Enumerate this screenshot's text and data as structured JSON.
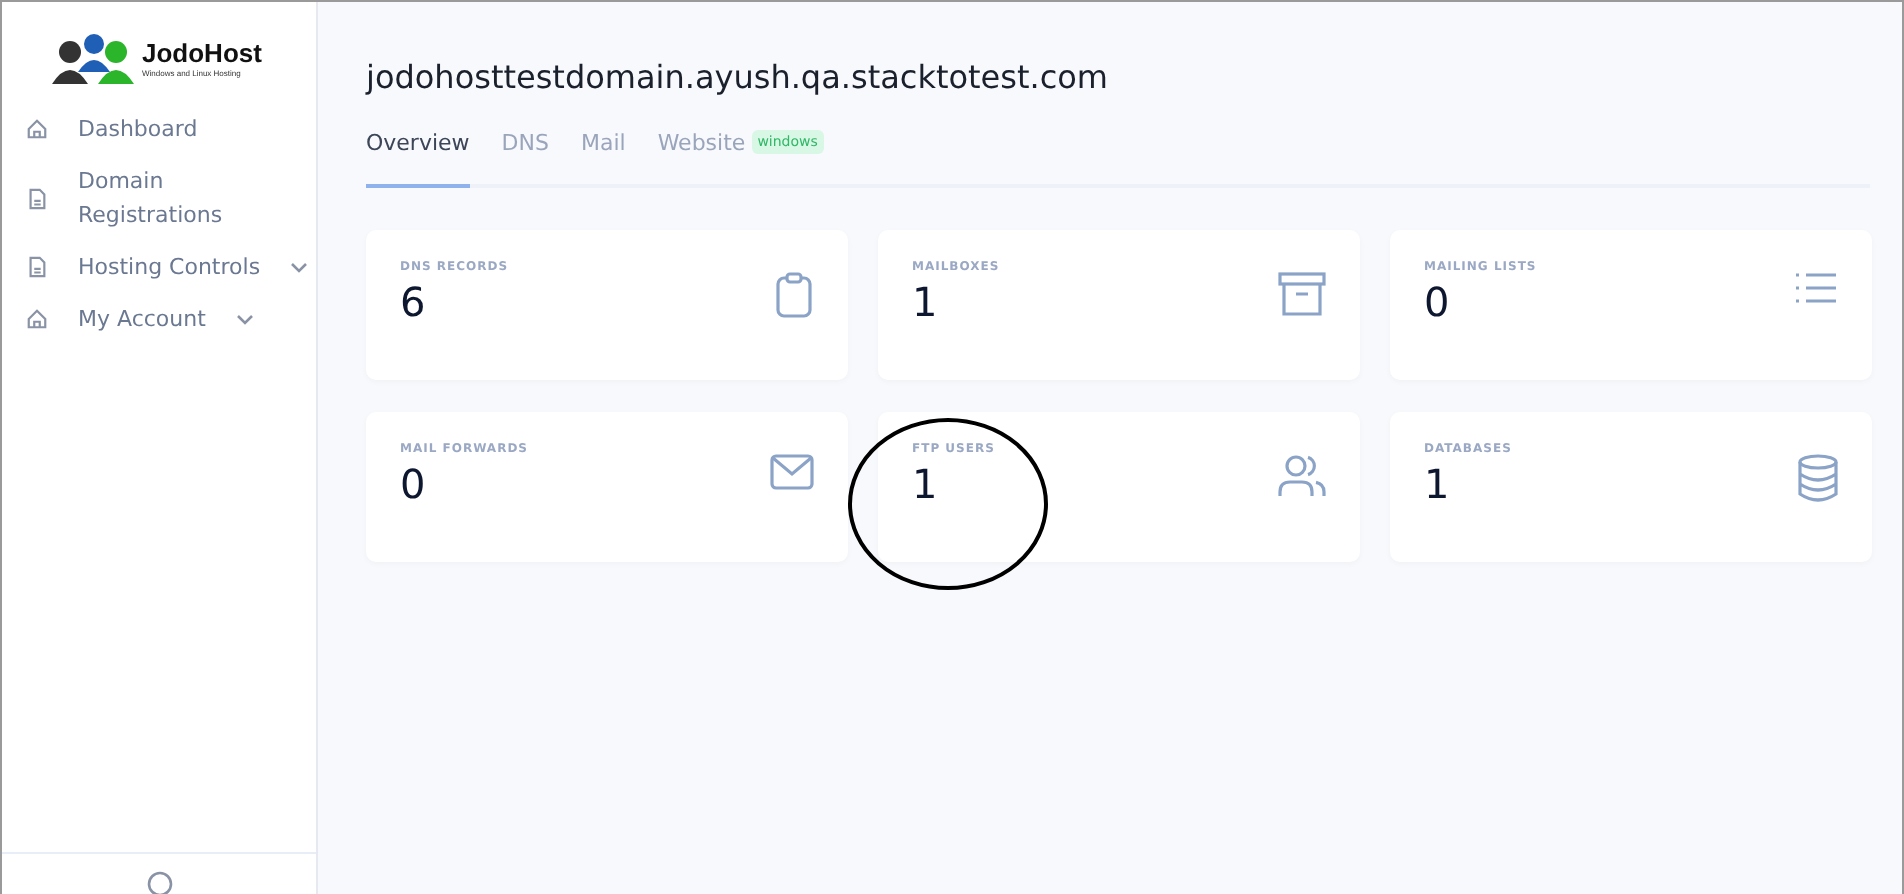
{
  "logo": {
    "name": "JodoHost",
    "tagline": "Windows and Linux Hosting"
  },
  "sidebar": {
    "items": [
      {
        "label": "Dashboard",
        "kind": "home",
        "expandable": false
      },
      {
        "label": "Domain Registrations",
        "kind": "document",
        "expandable": false
      },
      {
        "label": "Hosting Controls",
        "kind": "document",
        "expandable": true
      },
      {
        "label": "My Account",
        "kind": "home",
        "expandable": true
      }
    ]
  },
  "page": {
    "title": "jodohosttestdomain.ayush.qa.stacktotest.com"
  },
  "tabs": [
    {
      "label": "Overview",
      "selected": true
    },
    {
      "label": "DNS",
      "selected": false
    },
    {
      "label": "Mail",
      "selected": false
    },
    {
      "label": "Website",
      "selected": false,
      "badge": "windows"
    }
  ],
  "stats": [
    {
      "label": "DNS RECORDS",
      "value": "6",
      "kind": "clipboard",
      "circled": false
    },
    {
      "label": "MAILBOXES",
      "value": "1",
      "kind": "archive",
      "circled": false
    },
    {
      "label": "MAILING LISTS",
      "value": "0",
      "kind": "list",
      "circled": false
    },
    {
      "label": "MAIL FORWARDS",
      "value": "0",
      "kind": "mail",
      "circled": false
    },
    {
      "label": "FTP USERS",
      "value": "1",
      "kind": "users",
      "circled": true
    },
    {
      "label": "DATABASES",
      "value": "1",
      "kind": "database",
      "circled": false
    }
  ]
}
